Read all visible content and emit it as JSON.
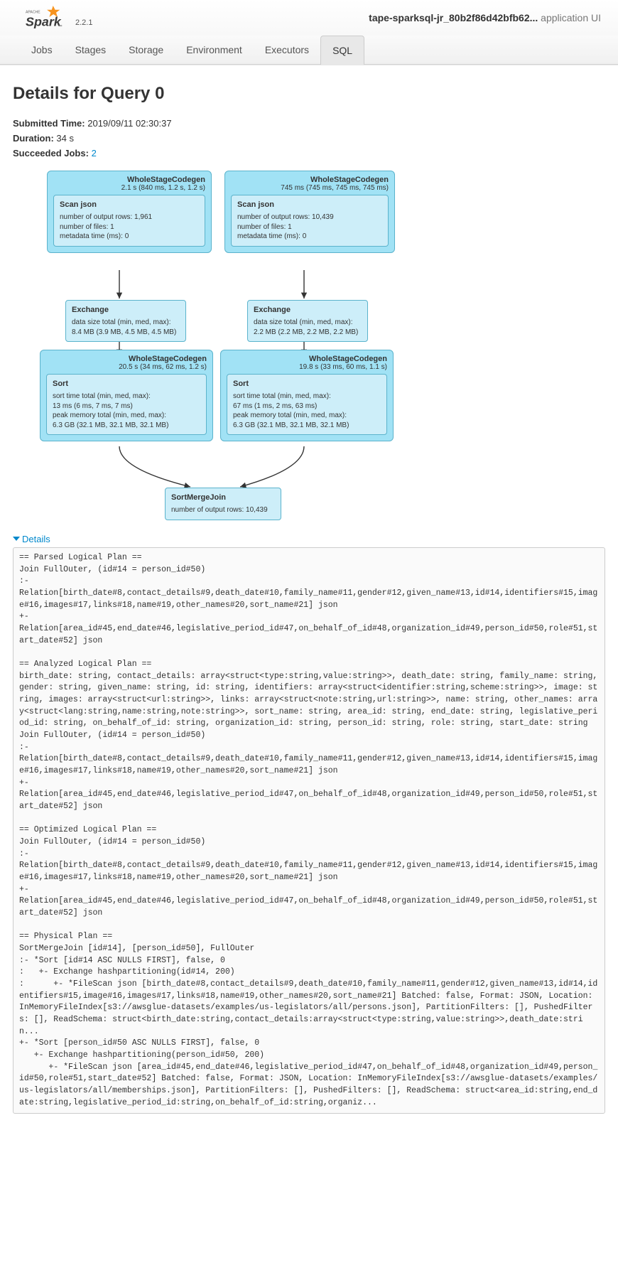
{
  "header": {
    "version": "2.2.1",
    "app_name": "tape-sparksql-jr_80b2f86d42bfb62...",
    "app_suffix": "application UI"
  },
  "tabs": {
    "jobs": "Jobs",
    "stages": "Stages",
    "storage": "Storage",
    "environment": "Environment",
    "executors": "Executors",
    "sql": "SQL"
  },
  "page": {
    "title": "Details for Query 0",
    "submitted_label": "Submitted Time:",
    "submitted_value": "2019/09/11 02:30:37",
    "duration_label": "Duration:",
    "duration_value": "34 s",
    "succeeded_label": "Succeeded Jobs:",
    "succeeded_value": "2"
  },
  "diagram": {
    "left": {
      "wsc1_title": "WholeStageCodegen",
      "wsc1_sub": "2.1 s (840 ms, 1.2 s, 1.2 s)",
      "scan_title": "Scan json",
      "scan_l1": "number of output rows: 1,961",
      "scan_l2": "number of files: 1",
      "scan_l3": "metadata time (ms): 0",
      "exch_title": "Exchange",
      "exch_l1": "data size total (min, med, max):",
      "exch_l2": "8.4 MB (3.9 MB, 4.5 MB, 4.5 MB)",
      "wsc2_title": "WholeStageCodegen",
      "wsc2_sub": "20.5 s (34 ms, 62 ms, 1.2 s)",
      "sort_title": "Sort",
      "sort_l1": "sort time total (min, med, max):",
      "sort_l2": "13 ms (6 ms, 7 ms, 7 ms)",
      "sort_l3": "peak memory total (min, med, max):",
      "sort_l4": "6.3 GB (32.1 MB, 32.1 MB, 32.1 MB)"
    },
    "right": {
      "wsc1_title": "WholeStageCodegen",
      "wsc1_sub": "745 ms (745 ms, 745 ms, 745 ms)",
      "scan_title": "Scan json",
      "scan_l1": "number of output rows: 10,439",
      "scan_l2": "number of files: 1",
      "scan_l3": "metadata time (ms): 0",
      "exch_title": "Exchange",
      "exch_l1": "data size total (min, med, max):",
      "exch_l2": "2.2 MB (2.2 MB, 2.2 MB, 2.2 MB)",
      "wsc2_title": "WholeStageCodegen",
      "wsc2_sub": "19.8 s (33 ms, 60 ms, 1.1 s)",
      "sort_title": "Sort",
      "sort_l1": "sort time total (min, med, max):",
      "sort_l2": "67 ms (1 ms, 2 ms, 63 ms)",
      "sort_l3": "peak memory total (min, med, max):",
      "sort_l4": "6.3 GB (32.1 MB, 32.1 MB, 32.1 MB)"
    },
    "join": {
      "title": "SortMergeJoin",
      "l1": "number of output rows: 10,439"
    }
  },
  "details": {
    "toggle": "Details",
    "plan": "== Parsed Logical Plan ==\nJoin FullOuter, (id#14 = person_id#50)\n:-\nRelation[birth_date#8,contact_details#9,death_date#10,family_name#11,gender#12,given_name#13,id#14,identifiers#15,image#16,images#17,links#18,name#19,other_names#20,sort_name#21] json\n+-\nRelation[area_id#45,end_date#46,legislative_period_id#47,on_behalf_of_id#48,organization_id#49,person_id#50,role#51,start_date#52] json\n\n== Analyzed Logical Plan ==\nbirth_date: string, contact_details: array<struct<type:string,value:string>>, death_date: string, family_name: string, gender: string, given_name: string, id: string, identifiers: array<struct<identifier:string,scheme:string>>, image: string, images: array<struct<url:string>>, links: array<struct<note:string,url:string>>, name: string, other_names: array<struct<lang:string,name:string,note:string>>, sort_name: string, area_id: string, end_date: string, legislative_period_id: string, on_behalf_of_id: string, organization_id: string, person_id: string, role: string, start_date: string\nJoin FullOuter, (id#14 = person_id#50)\n:-\nRelation[birth_date#8,contact_details#9,death_date#10,family_name#11,gender#12,given_name#13,id#14,identifiers#15,image#16,images#17,links#18,name#19,other_names#20,sort_name#21] json\n+-\nRelation[area_id#45,end_date#46,legislative_period_id#47,on_behalf_of_id#48,organization_id#49,person_id#50,role#51,start_date#52] json\n\n== Optimized Logical Plan ==\nJoin FullOuter, (id#14 = person_id#50)\n:-\nRelation[birth_date#8,contact_details#9,death_date#10,family_name#11,gender#12,given_name#13,id#14,identifiers#15,image#16,images#17,links#18,name#19,other_names#20,sort_name#21] json\n+-\nRelation[area_id#45,end_date#46,legislative_period_id#47,on_behalf_of_id#48,organization_id#49,person_id#50,role#51,start_date#52] json\n\n== Physical Plan ==\nSortMergeJoin [id#14], [person_id#50], FullOuter\n:- *Sort [id#14 ASC NULLS FIRST], false, 0\n:   +- Exchange hashpartitioning(id#14, 200)\n:      +- *FileScan json [birth_date#8,contact_details#9,death_date#10,family_name#11,gender#12,given_name#13,id#14,identifiers#15,image#16,images#17,links#18,name#19,other_names#20,sort_name#21] Batched: false, Format: JSON, Location: InMemoryFileIndex[s3://awsglue-datasets/examples/us-legislators/all/persons.json], PartitionFilters: [], PushedFilters: [], ReadSchema: struct<birth_date:string,contact_details:array<struct<type:string,value:string>>,death_date:strin...\n+- *Sort [person_id#50 ASC NULLS FIRST], false, 0\n   +- Exchange hashpartitioning(person_id#50, 200)\n      +- *FileScan json [area_id#45,end_date#46,legislative_period_id#47,on_behalf_of_id#48,organization_id#49,person_id#50,role#51,start_date#52] Batched: false, Format: JSON, Location: InMemoryFileIndex[s3://awsglue-datasets/examples/us-legislators/all/memberships.json], PartitionFilters: [], PushedFilters: [], ReadSchema: struct<area_id:string,end_date:string,legislative_period_id:string,on_behalf_of_id:string,organiz..."
  }
}
